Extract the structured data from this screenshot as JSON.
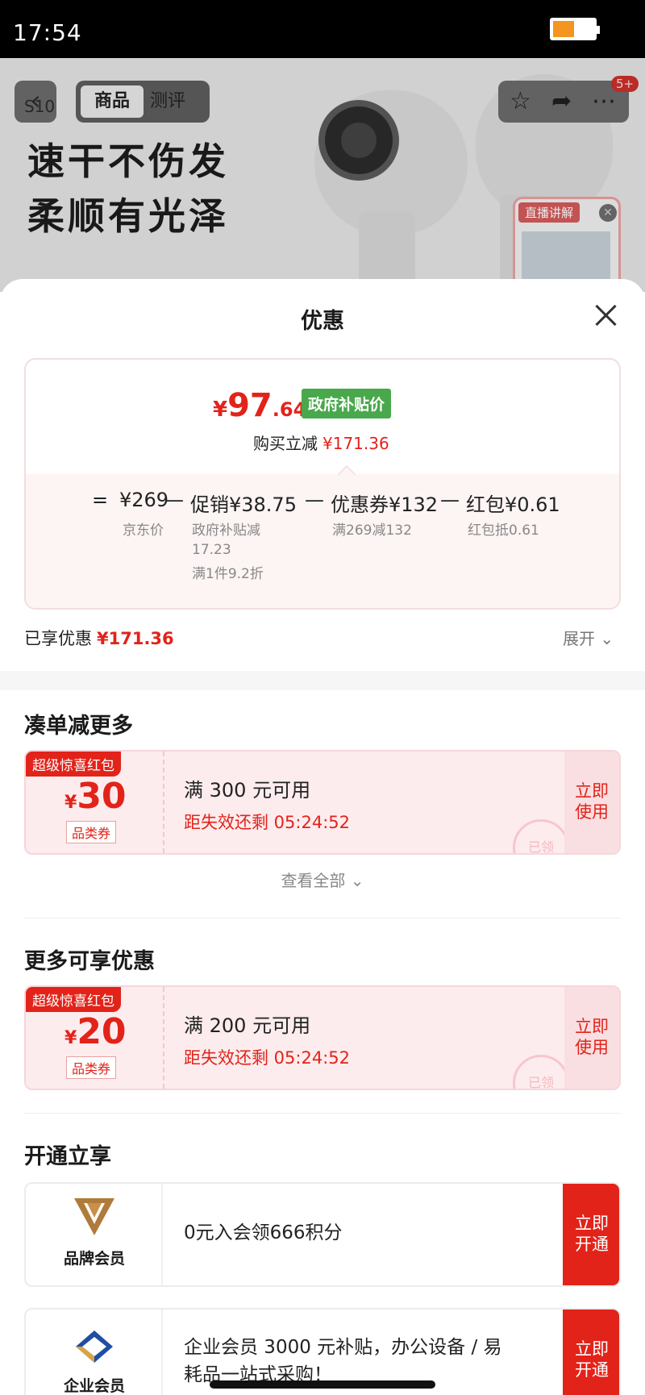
{
  "status_bar": {
    "time": "17:54"
  },
  "product_page": {
    "nav": {
      "tab_active": "商品",
      "tab_other": "测评",
      "left_text": "S10"
    },
    "badge": "5+",
    "hero_line1": "速干不伤发",
    "hero_line2": "柔顺有光泽",
    "live_tag": "直播讲解",
    "live_close": "✕"
  },
  "sheet": {
    "title": "优惠",
    "summary": {
      "final_price_yen": "¥",
      "final_price_int": "97",
      "final_price_dec": ".64",
      "gov_tag": "政府补贴价",
      "saving_label": "购买立减",
      "saving_amount": "¥171.36",
      "calc": [
        {
          "op": "=",
          "value": "¥269",
          "sub": [
            "京东价"
          ]
        },
        {
          "op": "—",
          "value": "促销¥38.75",
          "sub": [
            "政府补贴减",
            "17.23",
            "满1件9.2折"
          ]
        },
        {
          "op": "—",
          "value": "优惠券¥132",
          "sub": [
            "满269减132"
          ]
        },
        {
          "op": "—",
          "value": "红包¥0.61",
          "sub": [
            "红包抵0.61"
          ]
        }
      ]
    },
    "enjoyed_label": "已享优惠",
    "enjoyed_amount": "¥171.36",
    "expand_label": "展开",
    "section1": {
      "title": "凑单减更多",
      "coupon": {
        "tag": "超级惊喜红包",
        "yen": "¥",
        "amount": "30",
        "category": "品类券",
        "condition": "满 300 元可用",
        "expire": "距失效还剩 05:24:52",
        "use_line1": "立即",
        "use_line2": "使用",
        "stamp": "已领"
      },
      "see_all": "查看全部"
    },
    "section2": {
      "title": "更多可享优惠",
      "coupon": {
        "tag": "超级惊喜红包",
        "yen": "¥",
        "amount": "20",
        "category": "品类券",
        "condition": "满 200 元可用",
        "expire": "距失效还剩 05:24:52",
        "use_line1": "立即",
        "use_line2": "使用",
        "stamp": "已领"
      }
    },
    "section3": {
      "title": "开通立享",
      "members": [
        {
          "name": "品牌会员",
          "text": "0元入会领666积分",
          "open_line1": "立即",
          "open_line2": "开通"
        },
        {
          "name": "企业会员",
          "text_line1": "企业会员 3000 元补贴，办公设备 / 易",
          "text_line2": "耗品一站式采购！",
          "open_line1": "立即",
          "open_line2": "开通"
        }
      ]
    }
  },
  "colors": {
    "accent_red": "#e2231a",
    "gov_green": "#49a84c",
    "battery": "#f5941e"
  }
}
